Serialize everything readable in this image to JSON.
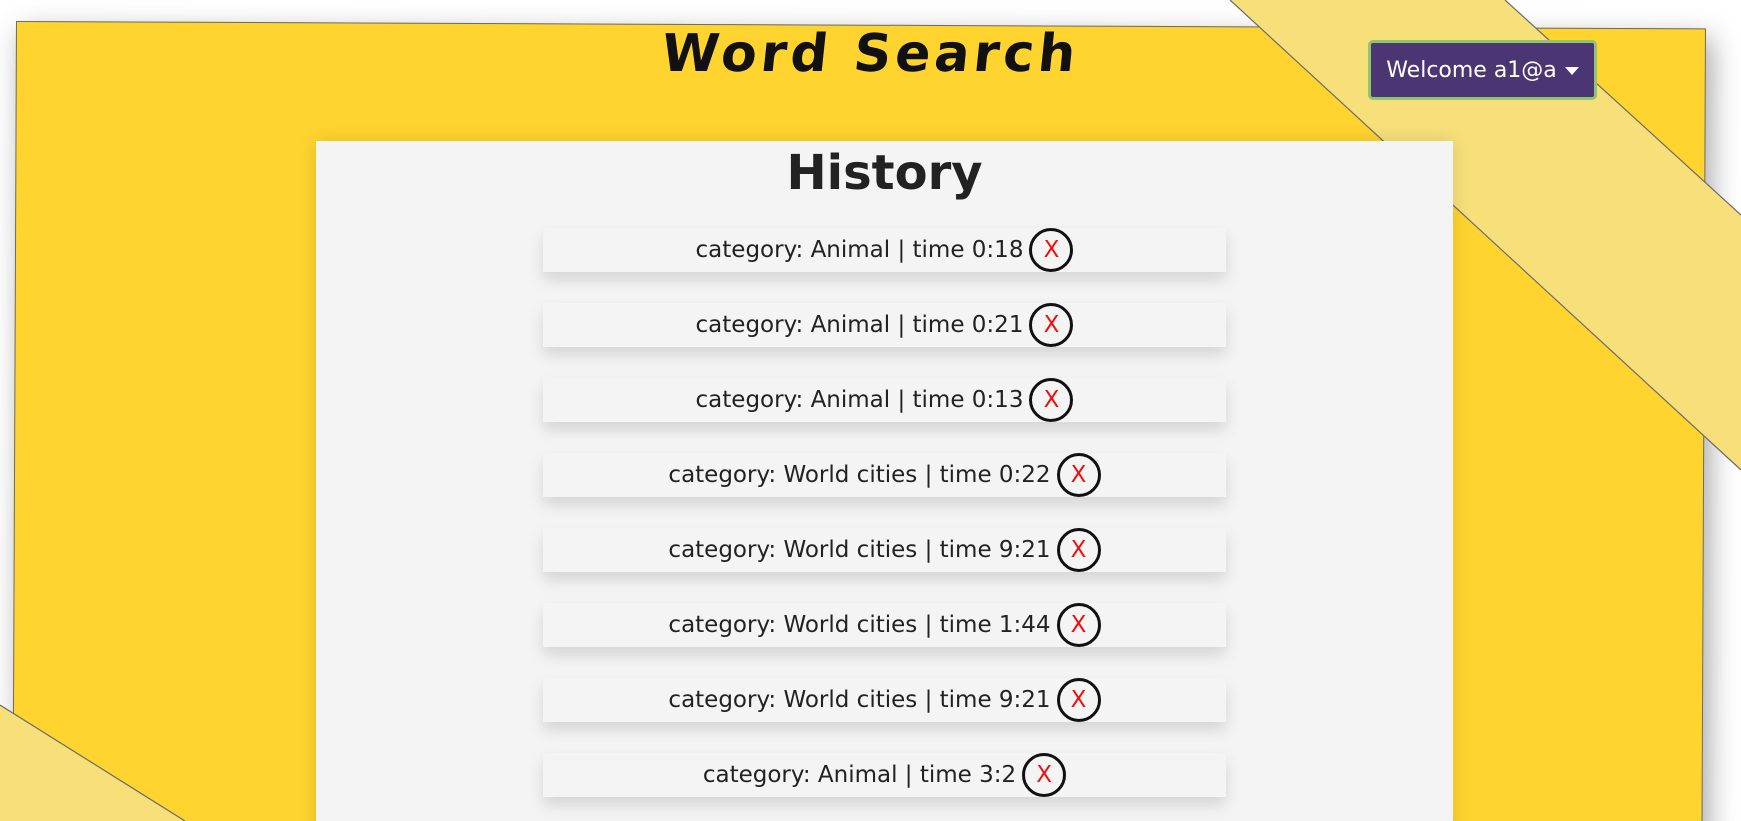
{
  "header": {
    "title": "Word Search"
  },
  "user_menu": {
    "label": "Welcome a1@a"
  },
  "history": {
    "title": "History",
    "delete_label": "X",
    "items": [
      {
        "text": "category: Animal | time 0:18"
      },
      {
        "text": "category: Animal | time 0:21"
      },
      {
        "text": "category: Animal | time 0:13"
      },
      {
        "text": "category: World cities | time 0:22"
      },
      {
        "text": "category: World cities | time 9:21"
      },
      {
        "text": "category: World cities | time 1:44"
      },
      {
        "text": "category: World cities | time 9:21"
      },
      {
        "text": "category: Animal | time 3:2"
      }
    ]
  },
  "colors": {
    "background": "#ffd42f",
    "panel": "#f4f4f4",
    "button": "#4b3673",
    "button_border": "#8fc471",
    "delete_x": "#ee1111"
  }
}
